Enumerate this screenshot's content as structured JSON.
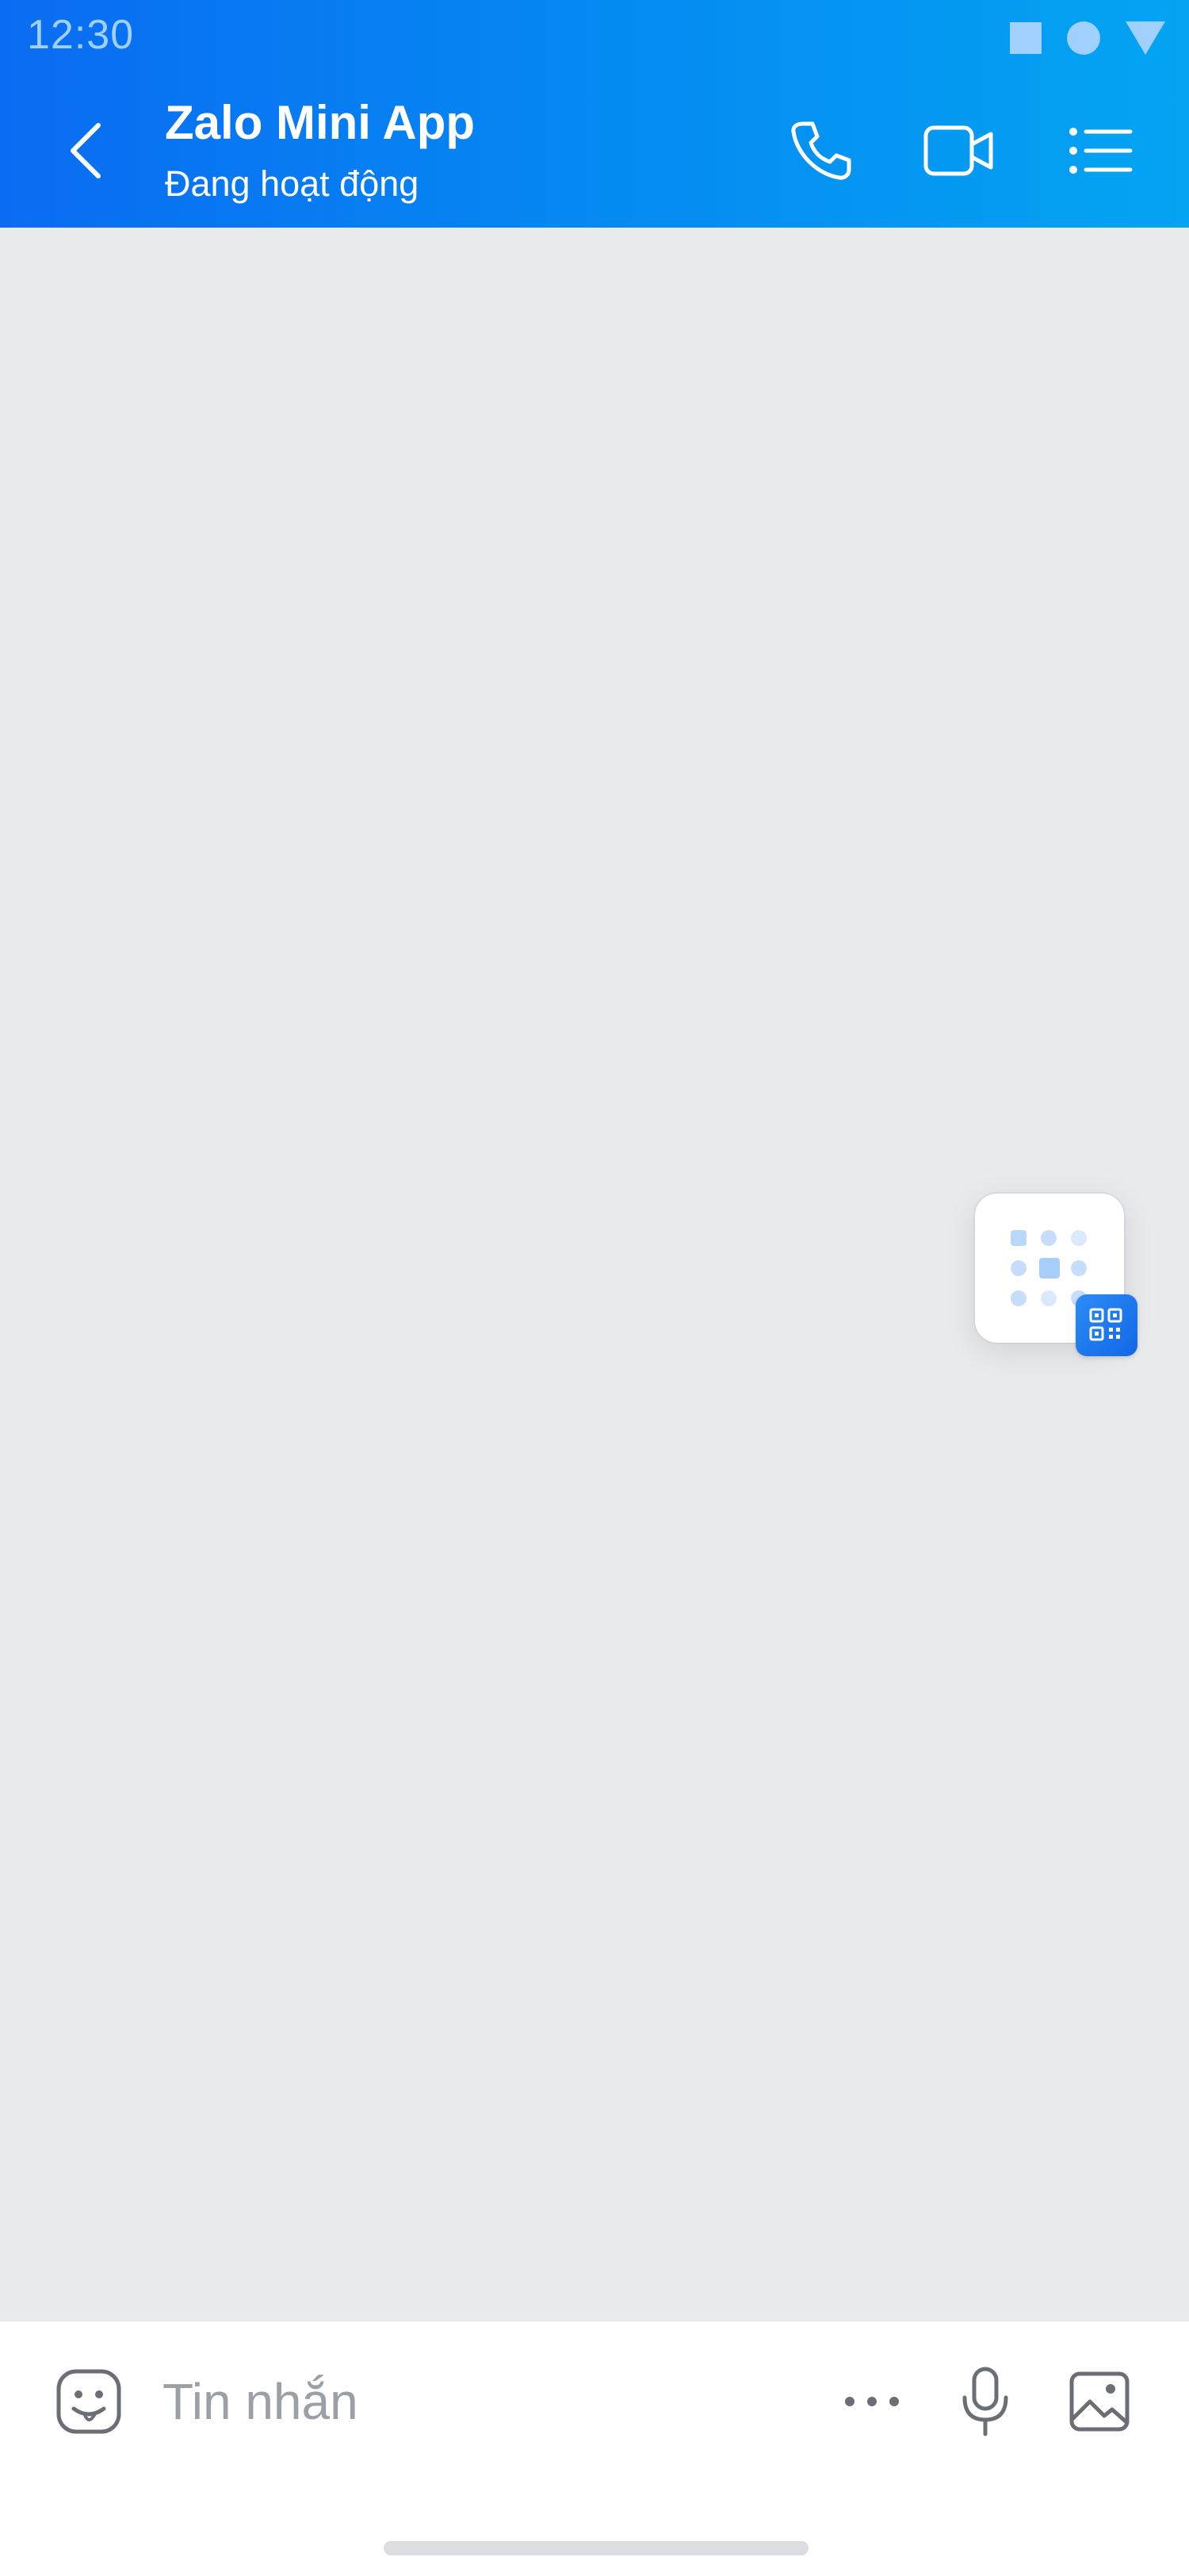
{
  "status_bar": {
    "time": "12:30",
    "icons": [
      "square-icon",
      "circle-icon",
      "triangle-icon"
    ]
  },
  "header": {
    "title": "Zalo Mini App",
    "subtitle": "Đang hoạt động",
    "back_icon": "chevron-left-icon",
    "actions": [
      "phone-icon",
      "video-camera-icon",
      "list-menu-icon"
    ]
  },
  "floating_widget": {
    "icon": "mini-app-grid-icon",
    "badge_icon": "qr-code-icon"
  },
  "composer": {
    "placeholder": "Tin nhắn",
    "value": "",
    "icons": [
      "sticker-icon",
      "more-dots-icon",
      "microphone-icon",
      "image-icon"
    ]
  },
  "colors": {
    "header_start": "#0a6cf2",
    "header_end": "#04a4f2",
    "chat_background": "#e9eaed",
    "icon_gray": "#6b6f75",
    "placeholder_gray": "#9aa0a6"
  }
}
